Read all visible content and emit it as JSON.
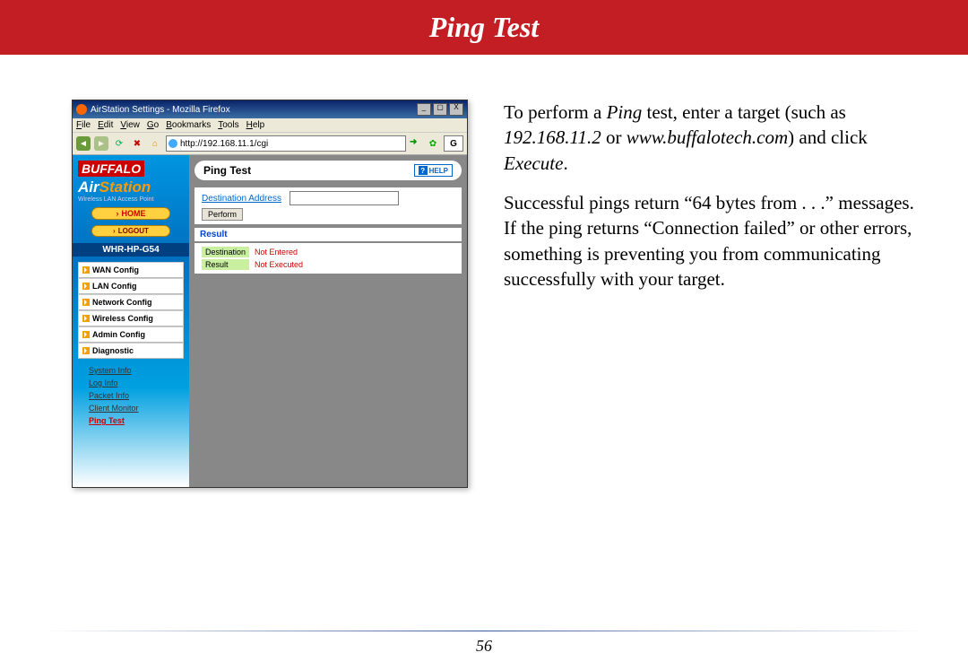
{
  "header": {
    "title": "Ping Test"
  },
  "window": {
    "title": "AirStation Settings - Mozilla Firefox",
    "menus": [
      "File",
      "Edit",
      "View",
      "Go",
      "Bookmarks",
      "Tools",
      "Help"
    ],
    "url": "http://192.168.11.1/cgi"
  },
  "branding": {
    "logo": "BUFFALO",
    "product_a": "Air",
    "product_b": "Station",
    "tagline": "Wireless LAN Access Point",
    "home_btn": "HOME",
    "logout_btn": "LOGOUT",
    "model": "WHR-HP-G54"
  },
  "nav": {
    "items": [
      {
        "label": "WAN Config"
      },
      {
        "label": "LAN Config"
      },
      {
        "label": "Network Config"
      },
      {
        "label": "Wireless Config"
      },
      {
        "label": "Admin Config"
      },
      {
        "label": "Diagnostic"
      }
    ],
    "subs": [
      {
        "label": "System Info"
      },
      {
        "label": "Log Info"
      },
      {
        "label": "Packet Info"
      },
      {
        "label": "Client Monitor"
      },
      {
        "label": "Ping Test"
      }
    ]
  },
  "panel": {
    "title": "Ping Test",
    "help": "HELP",
    "dest_label": "Destination Address",
    "perform": "Perform",
    "result_hdr": "Result",
    "rows": [
      {
        "k": "Destination",
        "v": "Not Entered"
      },
      {
        "k": "Result",
        "v": "Not Executed"
      }
    ]
  },
  "doc": {
    "p1a": "To perform a ",
    "p1b": "Ping",
    "p1c": " test, enter a target (such as ",
    "p1d": "192.168.11.2",
    "p1e": " or ",
    "p1f": "www.buffalotech.com",
    "p1g": ") and click ",
    "p1h": "Execute",
    "p1i": ".",
    "p2": "Successful pings return “64 bytes from . . .” messages.  If the ping returns “Connection failed” or other errors, something is preventing you from communicating successfully with your target."
  },
  "page_number": "56"
}
